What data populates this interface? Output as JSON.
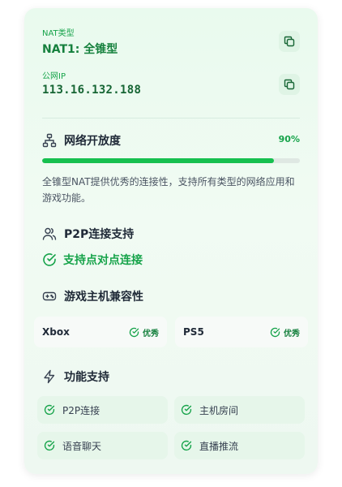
{
  "nat": {
    "label": "NAT类型",
    "value": "NAT1: 全锥型"
  },
  "public_ip": {
    "label": "公网IP",
    "value": "113.16.132.188"
  },
  "openness": {
    "title": "网络开放度",
    "percent_text": "90%",
    "percent": 90,
    "description": "全锥型NAT提供优秀的连接性，支持所有类型的网络应用和游戏功能。"
  },
  "p2p": {
    "title": "P2P连接支持",
    "status": "支持点对点连接"
  },
  "consoles": {
    "title": "游戏主机兼容性",
    "items": [
      {
        "name": "Xbox",
        "rating": "优秀"
      },
      {
        "name": "PS5",
        "rating": "优秀"
      }
    ]
  },
  "features": {
    "title": "功能支持",
    "items": [
      {
        "label": "P2P连接"
      },
      {
        "label": "主机房间"
      },
      {
        "label": "语音聊天"
      },
      {
        "label": "直播推流"
      }
    ]
  },
  "colors": {
    "accent": "#16a34a",
    "bar": "#16c04f",
    "card_bg": "#ecf9ef"
  }
}
